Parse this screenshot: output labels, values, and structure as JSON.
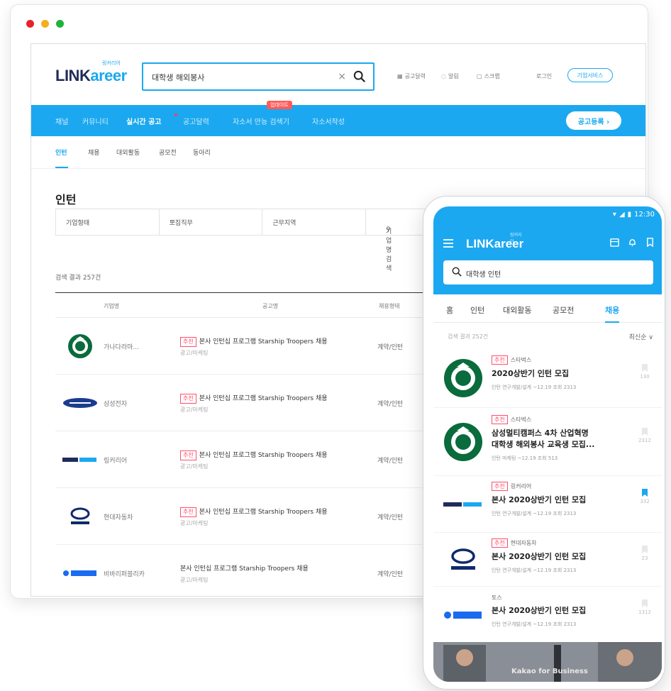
{
  "window": {
    "controls": {
      "close": "#e6232a",
      "minimize": "#f2b01e",
      "maximize": "#21b23d"
    }
  },
  "colors": {
    "brand": "#1ba8f0",
    "navy": "#1f2b5a",
    "badge": "#ff4d6d"
  },
  "desktop": {
    "logo": {
      "main": "LINK",
      "accent": "areer",
      "tag": "링커리어"
    },
    "search": {
      "value": "대학생 해외봉사"
    },
    "utils": [
      "공고달력",
      "알림",
      "스크랩"
    ],
    "login": "로그인",
    "corp_button": "기업서비스",
    "gnb": {
      "items": [
        "채널",
        "커뮤니티",
        "실시간 공고",
        "공고달력",
        "자소서 만능 검색기",
        "자소서작성"
      ],
      "hot_label": "업데이트",
      "post_button": "공고등록 ›"
    },
    "subnav": [
      "인턴",
      "채용",
      "대외활동",
      "공모전",
      "동아리"
    ],
    "section_title": "인턴",
    "filters": [
      "기업형태",
      "모집직무",
      "근무지역",
      "기업명 검색"
    ],
    "result_count": "검색 결과 257건",
    "table_headers": [
      "기업명",
      "공고명",
      "채용형태"
    ],
    "rows": [
      {
        "company": "가나다라마...",
        "badge": "추천",
        "title": "본사 인턴십 프로그램 Starship Troopers 채용",
        "sub": "광고/마케팅",
        "type": "계약/인턴",
        "logo": "starbucks-logo"
      },
      {
        "company": "삼성전자",
        "badge": "추천",
        "title": "본사 인턴십 프로그램 Starship Troopers 채용",
        "sub": "광고/마케팅",
        "type": "계약/인턴",
        "logo": "samsung-logo"
      },
      {
        "company": "링커리어",
        "badge": "추천",
        "title": "본사 인턴십 프로그램 Starship Troopers 채용",
        "sub": "광고/마케팅",
        "type": "계약/인턴",
        "logo": "linkareer-logo"
      },
      {
        "company": "현대자동차",
        "badge": "추천",
        "title": "본사 인턴십 프로그램 Starship Troopers 채용",
        "sub": "광고/마케팅",
        "type": "계약/인턴",
        "logo": "hyundai-logo"
      },
      {
        "company": "비바리퍼블리카",
        "badge": "",
        "title": "본사 인턴십 프로그램 Starship Troopers 채용",
        "sub": "광고/마케팅",
        "type": "계약/인턴",
        "logo": "toss-logo"
      }
    ]
  },
  "mobile": {
    "status_time": "12:30",
    "logo": {
      "main": "LINKareer",
      "tag": "링커리어"
    },
    "search": {
      "value": "대학생 인턴"
    },
    "tabs": [
      "홈",
      "인턴",
      "대외활동",
      "공모전",
      "채용"
    ],
    "result_count": "검색 결과 252건",
    "sort": "최신순",
    "items": [
      {
        "badge": "추천",
        "company": "스타벅스",
        "title": "2020상반기 인턴 모집",
        "meta": "인턴  연구개발/설계  ~12.19  조회 2313",
        "bookmark": "130",
        "logo": "starbucks-logo"
      },
      {
        "badge": "추천",
        "company": "스타벅스",
        "title": "삼성멀티캠퍼스 4차 산업혁명",
        "title2": "대학생 해외봉사 교육생 모집...",
        "meta": "인턴  마케팅  ~12.19  조회 513",
        "bookmark": "2312",
        "logo": "starbucks-logo"
      },
      {
        "badge": "추천",
        "company": "링커리어",
        "title": "본사 2020상반기 인턴 모집",
        "meta": "인턴  연구개발/설계  ~12.19  조회 2313",
        "bookmark": "332",
        "logo": "linkareer-logo"
      },
      {
        "badge": "추천",
        "company": "현대자동차",
        "title": "본사 2020상반기 인턴 모집",
        "meta": "인턴  연구개발/설계  ~12.19  조회 2313",
        "bookmark": "23",
        "logo": "hyundai-logo"
      },
      {
        "badge": "",
        "company": "토스",
        "title": "본사 2020상반기 인턴 모집",
        "meta": "인턴  연구개발/설계  ~12.19  조회 2313",
        "bookmark": "1312",
        "logo": "toss-logo"
      }
    ],
    "banner_text": "Kakao for Business"
  }
}
